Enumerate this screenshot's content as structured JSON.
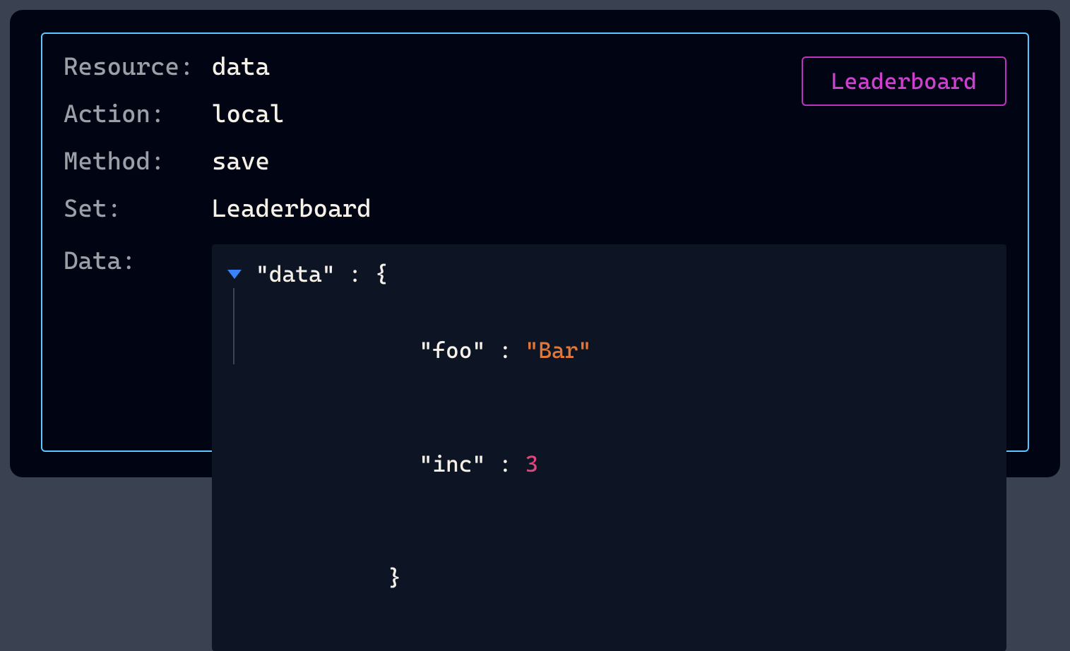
{
  "fields": {
    "resource": {
      "label": "Resource:",
      "value": "data"
    },
    "action": {
      "label": "Action:",
      "value": "local"
    },
    "method": {
      "label": "Method:",
      "value": "save"
    },
    "set": {
      "label": "Set:",
      "value": "Leaderboard"
    },
    "data": {
      "label": "Data:"
    }
  },
  "button": {
    "leaderboard": "Leaderboard"
  },
  "json": {
    "root_key": "\"data\"",
    "open": " : {",
    "entries": [
      {
        "key": "\"foo\"",
        "sep": " : ",
        "value": "\"Bar\"",
        "type": "string"
      },
      {
        "key": "\"inc\"",
        "sep": " : ",
        "value": "3",
        "type": "number"
      }
    ],
    "close": "}"
  }
}
